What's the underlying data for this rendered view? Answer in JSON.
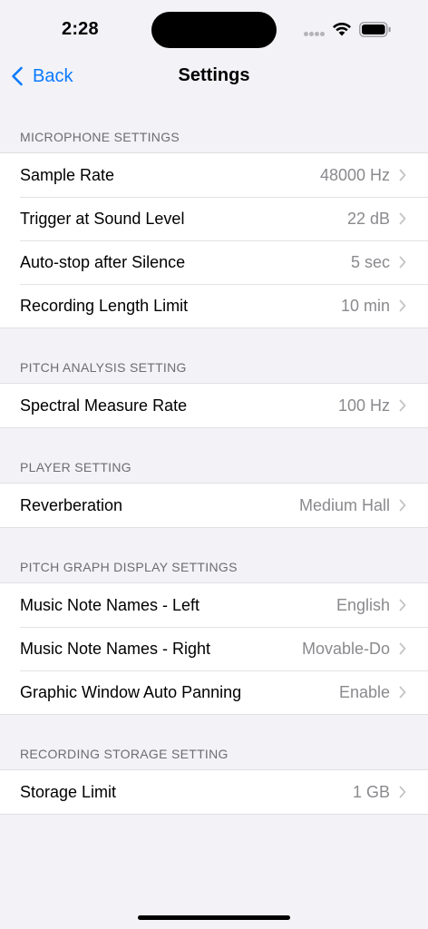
{
  "status_bar": {
    "time": "2:28",
    "icons": [
      "signal-dots-icon",
      "wifi-icon",
      "battery-icon"
    ]
  },
  "nav": {
    "back_label": "Back",
    "title": "Settings"
  },
  "colors": {
    "accent": "#0a7aff",
    "background": "#f2f2f7",
    "secondary_text": "#8a8a8e"
  },
  "sections": [
    {
      "header": "MICROPHONE SETTINGS",
      "rows": [
        {
          "label": "Sample Rate",
          "value": "48000 Hz"
        },
        {
          "label": "Trigger at Sound Level",
          "value": "22 dB"
        },
        {
          "label": "Auto-stop after Silence",
          "value": "5 sec"
        },
        {
          "label": "Recording Length Limit",
          "value": "10 min"
        }
      ]
    },
    {
      "header": "PITCH ANALYSIS SETTING",
      "rows": [
        {
          "label": "Spectral Measure Rate",
          "value": "100 Hz"
        }
      ]
    },
    {
      "header": "PLAYER SETTING",
      "rows": [
        {
          "label": "Reverberation",
          "value": "Medium Hall"
        }
      ]
    },
    {
      "header": "PITCH GRAPH DISPLAY SETTINGS",
      "rows": [
        {
          "label": "Music Note Names - Left",
          "value": "English"
        },
        {
          "label": "Music Note Names - Right",
          "value": "Movable-Do"
        },
        {
          "label": "Graphic Window Auto Panning",
          "value": "Enable"
        }
      ]
    },
    {
      "header": "RECORDING STORAGE SETTING",
      "rows": [
        {
          "label": "Storage Limit",
          "value": "1 GB"
        }
      ]
    }
  ]
}
